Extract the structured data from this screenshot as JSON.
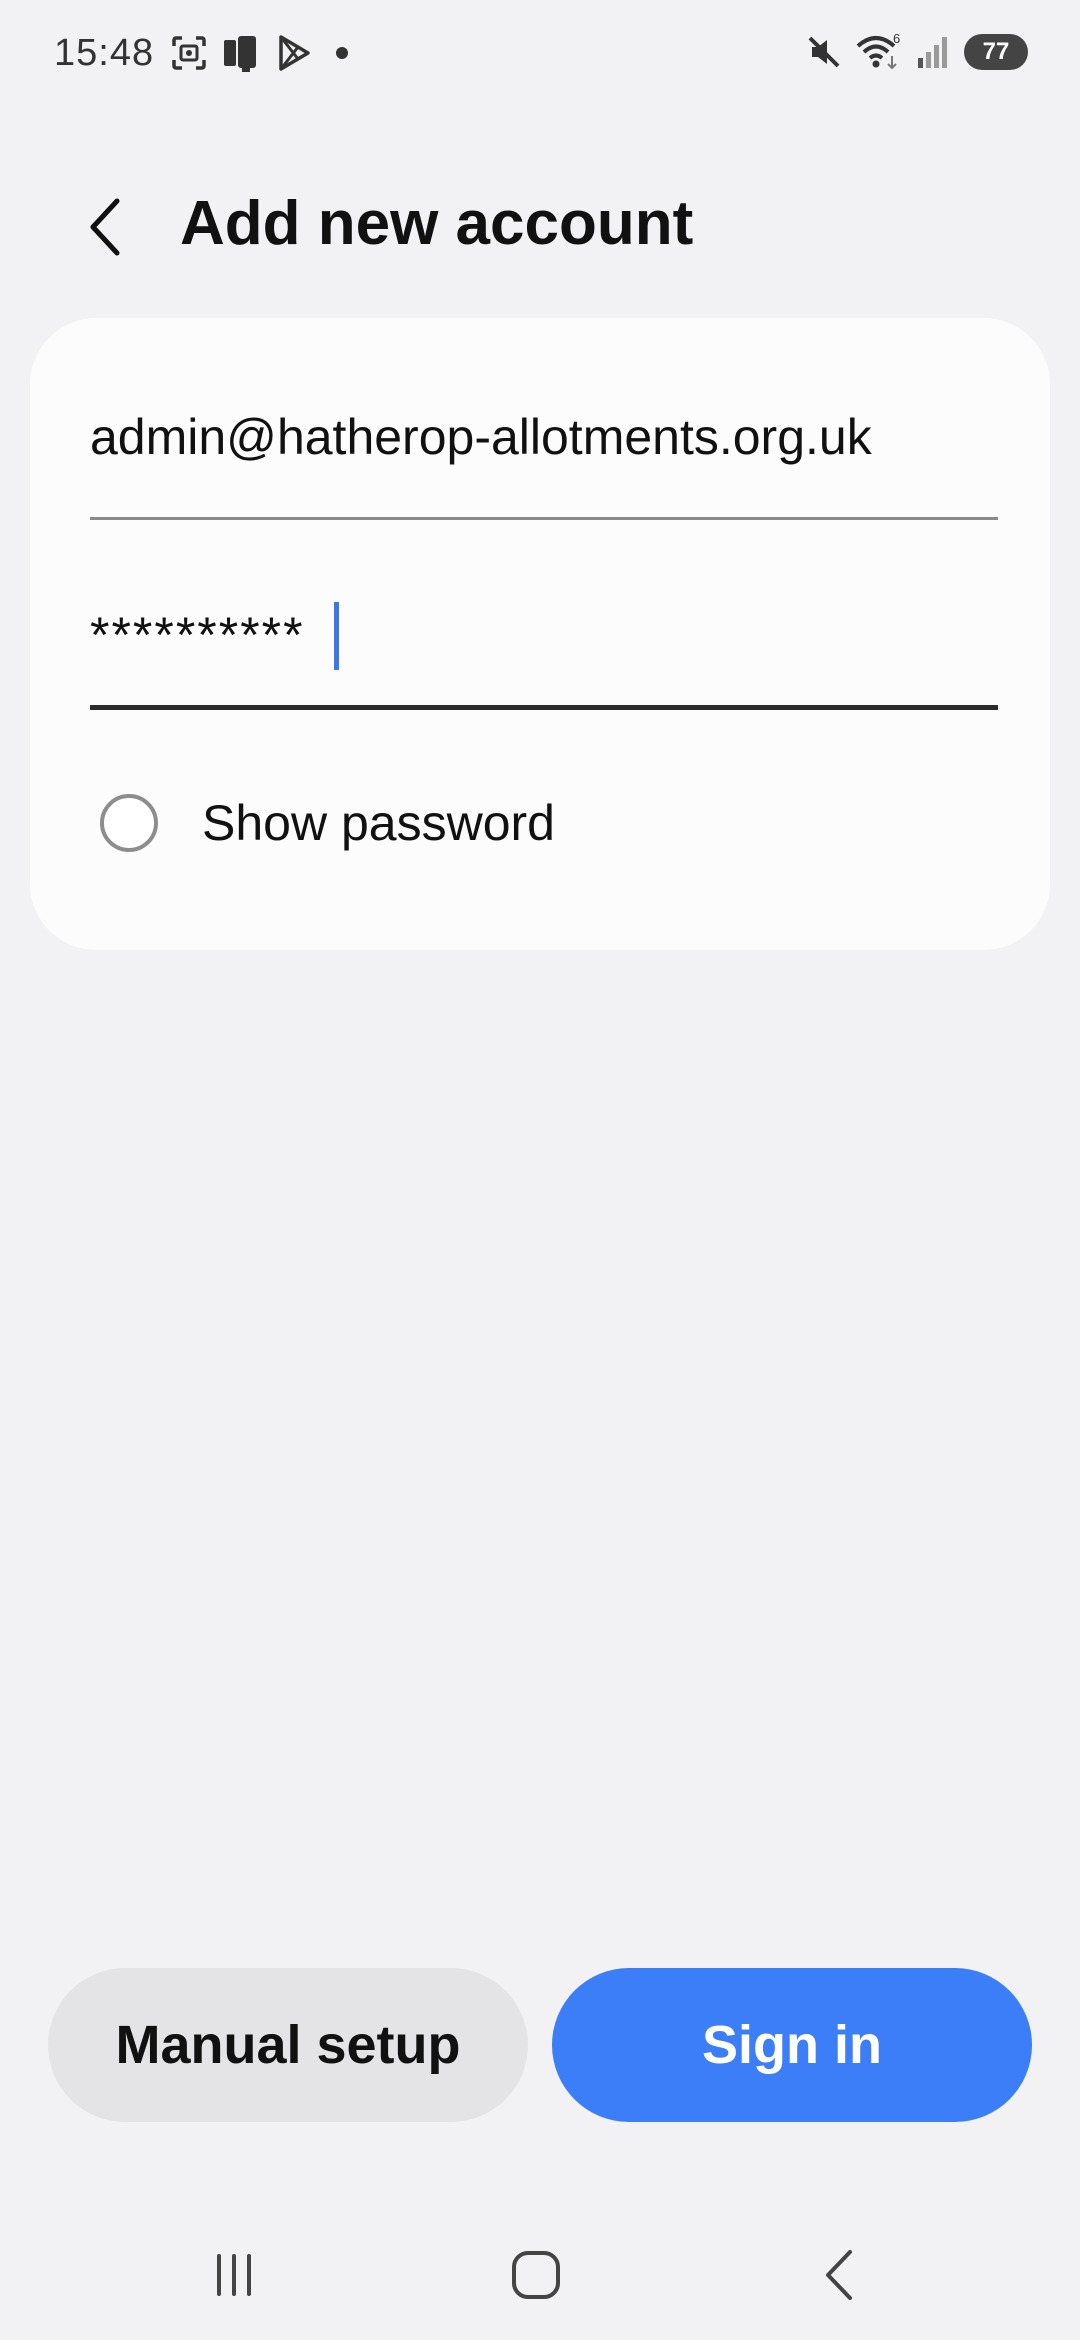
{
  "status_bar": {
    "time": "15:48",
    "left_icons": [
      "screenshot-icon",
      "phone-link-icon",
      "play-store-icon",
      "notification-dot"
    ],
    "right_icons": [
      "mute-icon",
      "wifi-icon",
      "signal-icon"
    ],
    "wifi_badge": "6",
    "battery": "77"
  },
  "header": {
    "title": "Add new account",
    "back_icon": "back-arrow-icon"
  },
  "form": {
    "email_value": "admin@hatherop-allotments.org.uk",
    "password_value": "**********",
    "show_password_label": "Show password",
    "show_password_checked": false
  },
  "buttons": {
    "manual_setup": "Manual setup",
    "sign_in": "Sign in"
  },
  "nav_bar": {
    "items": [
      "recent-apps-icon",
      "home-icon",
      "back-icon"
    ]
  },
  "colors": {
    "background": "#f2f2f5",
    "card": "#fcfcfc",
    "accent": "#3c7ef7",
    "caret": "#3b78e7",
    "secondary_button": "#e4e4e6"
  }
}
